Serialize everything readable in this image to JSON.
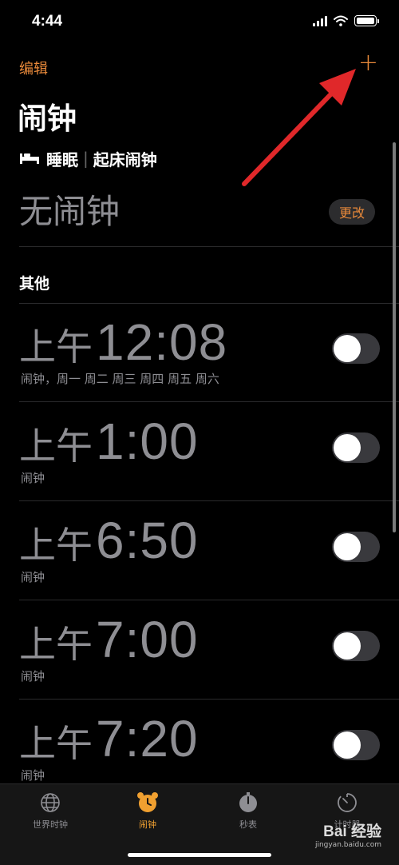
{
  "status_bar": {
    "time": "4:44"
  },
  "nav": {
    "edit_label": "编辑",
    "add_label": "+"
  },
  "title": "闹钟",
  "sleep": {
    "label_left": "睡眠",
    "separator": "|",
    "label_right": "起床闹钟",
    "no_alarm": "无闹钟",
    "change_label": "更改"
  },
  "section_other": "其他",
  "alarms": [
    {
      "ampm": "上午",
      "time": "12:08",
      "label": "闹钟，周一 周二 周三 周四 周五 周六",
      "enabled": false
    },
    {
      "ampm": "上午",
      "time": "1:00",
      "label": "闹钟",
      "enabled": false
    },
    {
      "ampm": "上午",
      "time": "6:50",
      "label": "闹钟",
      "enabled": false
    },
    {
      "ampm": "上午",
      "time": "7:00",
      "label": "闹钟",
      "enabled": false
    },
    {
      "ampm": "上午",
      "time": "7:20",
      "label": "闹钟",
      "enabled": false
    }
  ],
  "tabs": [
    {
      "label": "世界时钟",
      "icon": "globe-icon",
      "active": false
    },
    {
      "label": "闹钟",
      "icon": "alarm-clock-icon",
      "active": true
    },
    {
      "label": "秒表",
      "icon": "stopwatch-icon",
      "active": false
    },
    {
      "label": "计时器",
      "icon": "timer-icon",
      "active": false
    }
  ],
  "watermark": {
    "main": "Bai 经验",
    "sub": "jingyan.baidu.com"
  },
  "colors": {
    "accent": "#e8893a",
    "tab_active": "#f0a030",
    "annotation_arrow": "#e0282a"
  }
}
